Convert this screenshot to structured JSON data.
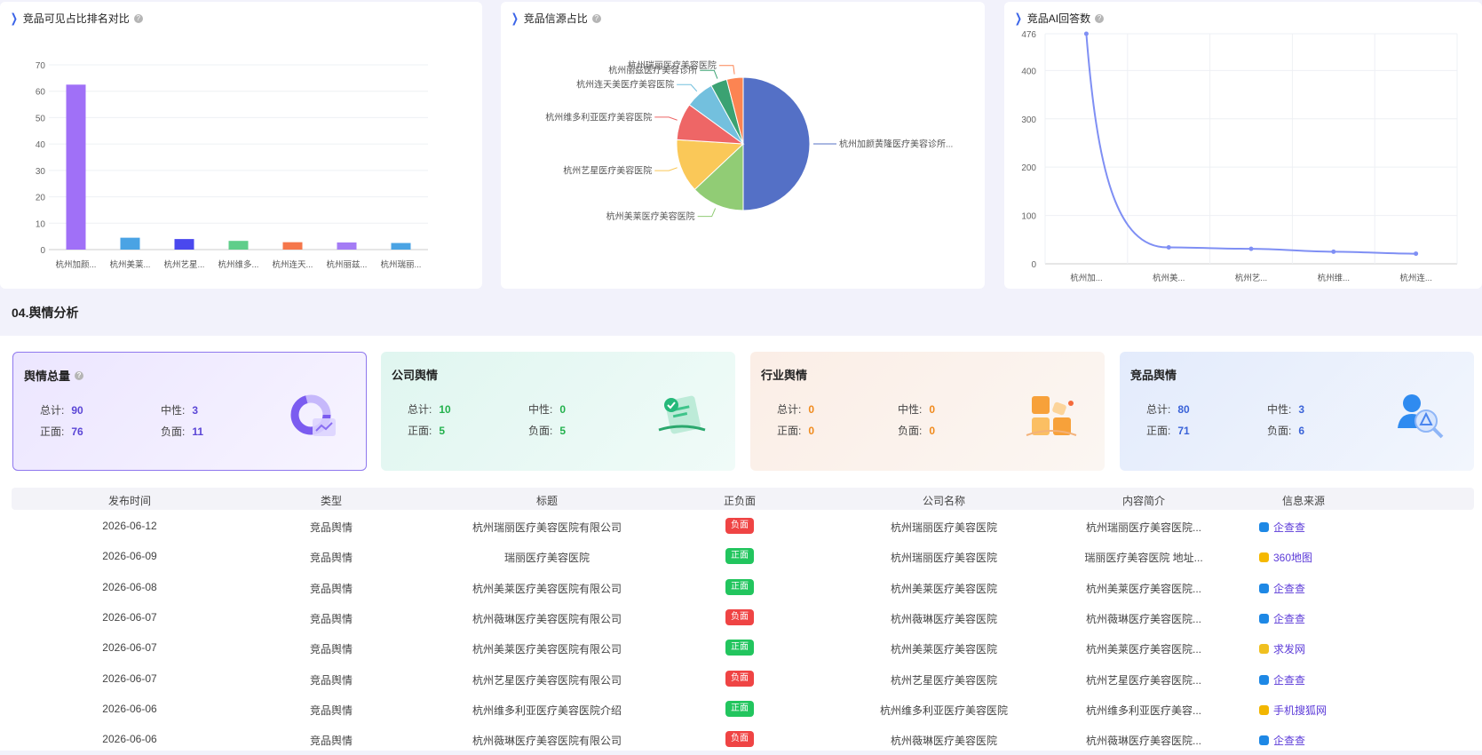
{
  "charts": {
    "bar": {
      "title": "竞品可见占比排名对比",
      "chart_data": {
        "type": "bar",
        "categories": [
          "杭州加颜...",
          "杭州美莱...",
          "杭州艺星...",
          "杭州维多...",
          "杭州连天...",
          "杭州丽兹...",
          "杭州瑞丽..."
        ],
        "values": [
          62.5,
          4.5,
          4.0,
          3.3,
          2.8,
          2.7,
          2.5
        ],
        "colors": [
          "#a070f7",
          "#4aa3e4",
          "#4a48ee",
          "#5fce8a",
          "#f5774b",
          "#a47cf5",
          "#4aa3e4"
        ],
        "yticks": [
          0,
          10,
          20,
          30,
          40,
          50,
          60,
          70
        ],
        "ylim": [
          0,
          70
        ]
      }
    },
    "pie": {
      "title": "竞品信源占比",
      "chart_data": {
        "type": "pie",
        "slices": [
          {
            "label": "杭州加颜黄隆医疗美容诊所...",
            "value": 50,
            "color": "#5470c6"
          },
          {
            "label": "杭州美莱医疗美容医院",
            "value": 13,
            "color": "#91cc75"
          },
          {
            "label": "杭州艺星医疗美容医院",
            "value": 13,
            "color": "#fac858"
          },
          {
            "label": "杭州维多利亚医疗美容医院",
            "value": 9,
            "color": "#ee6666"
          },
          {
            "label": "杭州连天美医疗美容医院",
            "value": 7,
            "color": "#73c0de"
          },
          {
            "label": "杭州丽兹医疗美容诊所",
            "value": 4,
            "color": "#3ba272"
          },
          {
            "label": "杭州瑞丽医疗美容医院",
            "value": 4,
            "color": "#fc8452"
          }
        ]
      }
    },
    "line": {
      "title": "竞品AI回答数",
      "chart_data": {
        "type": "line",
        "categories": [
          "杭州加...",
          "杭州美...",
          "杭州艺...",
          "杭州维...",
          "杭州连..."
        ],
        "values": [
          476,
          34,
          31,
          25,
          21
        ],
        "yticks": [
          0,
          100,
          200,
          300,
          400,
          476
        ],
        "ylim": [
          0,
          476
        ],
        "color": "#7f8ff4"
      }
    }
  },
  "section": {
    "title": "04.舆情分析"
  },
  "stats": [
    {
      "title": "舆情总量",
      "help": "?",
      "total_label": "总计:",
      "total": "90",
      "neutral_label": "中性:",
      "neutral": "3",
      "pos_label": "正面:",
      "pos": "76",
      "neg_label": "负面:",
      "neg": "11",
      "color": "#5b46d6",
      "icon": "donut-chart-icon"
    },
    {
      "title": "公司舆情",
      "total_label": "总计:",
      "total": "10",
      "neutral_label": "中性:",
      "neutral": "0",
      "pos_label": "正面:",
      "pos": "5",
      "neg_label": "负面:",
      "neg": "5",
      "color": "#22b14c",
      "icon": "certificate-icon"
    },
    {
      "title": "行业舆情",
      "total_label": "总计:",
      "total": "0",
      "neutral_label": "中性:",
      "neutral": "0",
      "pos_label": "正面:",
      "pos": "0",
      "neg_label": "负面:",
      "neg": "0",
      "color": "#f08a1c",
      "icon": "blocks-icon"
    },
    {
      "title": "竞品舆情",
      "total_label": "总计:",
      "total": "80",
      "neutral_label": "中性:",
      "neutral": "3",
      "pos_label": "正面:",
      "pos": "71",
      "neg_label": "负面:",
      "neg": "6",
      "color": "#3a63d8",
      "icon": "user-search-icon"
    }
  ],
  "table": {
    "headers": [
      "发布时间",
      "类型",
      "标题",
      "正负面",
      "公司名称",
      "内容简介",
      "信息来源"
    ],
    "rows": [
      {
        "date": "2026-06-12",
        "type": "竞品舆情",
        "title": "杭州瑞丽医疗美容医院有限公司",
        "sentiment": "负面",
        "company": "杭州瑞丽医疗美容医院",
        "summary": "杭州瑞丽医疗美容医院...",
        "source": "企查查",
        "source_icon": "qcc-icon"
      },
      {
        "date": "2026-06-09",
        "type": "竞品舆情",
        "title": "瑞丽医疗美容医院",
        "sentiment": "正面",
        "company": "杭州瑞丽医疗美容医院",
        "summary": "瑞丽医疗美容医院 地址...",
        "source": "360地图",
        "source_icon": "map360-icon"
      },
      {
        "date": "2026-06-08",
        "type": "竞品舆情",
        "title": "杭州美莱医疗美容医院有限公司",
        "sentiment": "正面",
        "company": "杭州美莱医疗美容医院",
        "summary": "杭州美莱医疗美容医院...",
        "source": "企查查",
        "source_icon": "qcc-icon"
      },
      {
        "date": "2026-06-07",
        "type": "竞品舆情",
        "title": "杭州薇琳医疗美容医院有限公司",
        "sentiment": "负面",
        "company": "杭州薇琳医疗美容医院",
        "summary": "杭州薇琳医疗美容医院...",
        "source": "企查查",
        "source_icon": "qcc-icon"
      },
      {
        "date": "2026-06-07",
        "type": "竞品舆情",
        "title": "杭州美莱医疗美容医院有限公司",
        "sentiment": "正面",
        "company": "杭州美莱医疗美容医院",
        "summary": "杭州美莱医疗美容医院...",
        "source": "求发网",
        "source_icon": "qiufa-icon"
      },
      {
        "date": "2026-06-07",
        "type": "竞品舆情",
        "title": "杭州艺星医疗美容医院有限公司",
        "sentiment": "负面",
        "company": "杭州艺星医疗美容医院",
        "summary": "杭州艺星医疗美容医院...",
        "source": "企查查",
        "source_icon": "qcc-icon"
      },
      {
        "date": "2026-06-06",
        "type": "竞品舆情",
        "title": "杭州维多利亚医疗美容医院介绍",
        "sentiment": "正面",
        "company": "杭州维多利亚医疗美容医院",
        "summary": "杭州维多利亚医疗美容...",
        "source": "手机搜狐网",
        "source_icon": "sohu-icon"
      },
      {
        "date": "2026-06-06",
        "type": "竞品舆情",
        "title": "杭州薇琳医疗美容医院有限公司",
        "sentiment": "负面",
        "company": "杭州薇琳医疗美容医院",
        "summary": "杭州薇琳医疗美容医院...",
        "source": "企查查",
        "source_icon": "qcc-icon"
      }
    ]
  },
  "colors": {
    "positive": "#22c55e",
    "negative": "#ef4444",
    "accent": "#3b64e8"
  }
}
